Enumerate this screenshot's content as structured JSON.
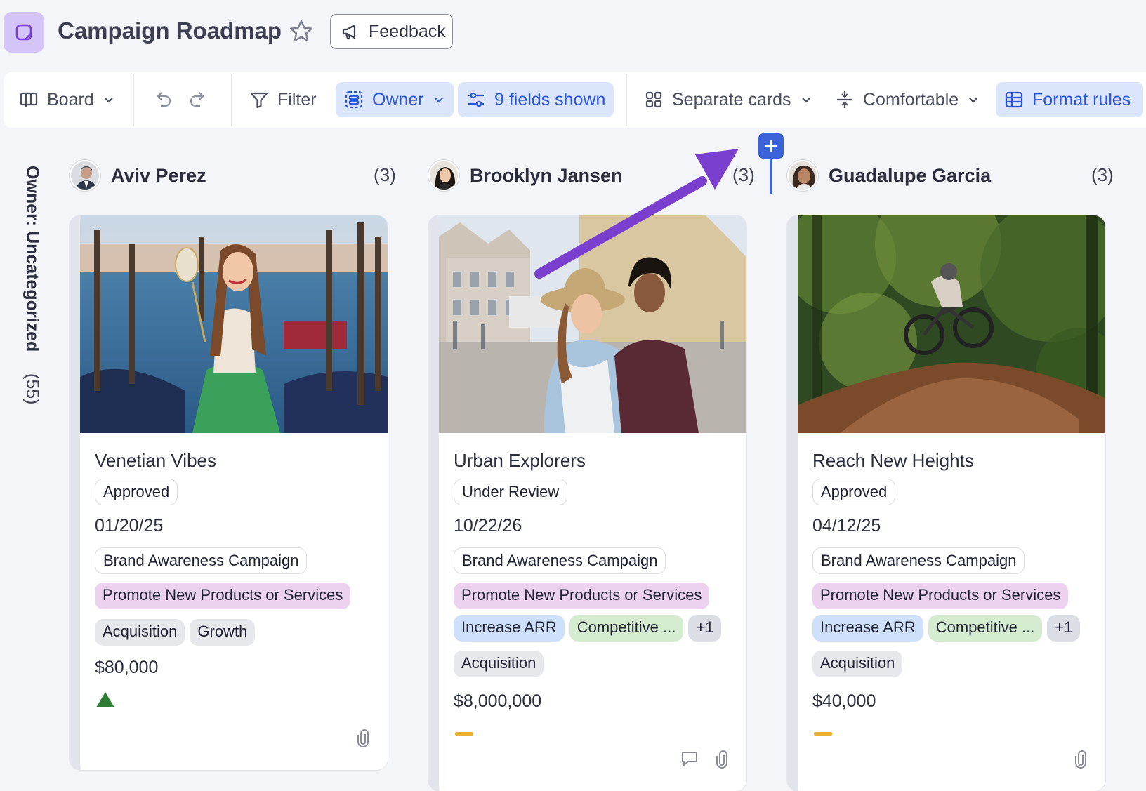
{
  "header": {
    "title": "Campaign Roadmap",
    "feedback_label": "Feedback"
  },
  "toolbar": {
    "board_label": "Board",
    "filter_label": "Filter",
    "owner_label": "Owner",
    "fields_label": "9 fields shown",
    "separate_cards_label": "Separate cards",
    "density_label": "Comfortable",
    "format_rules_label": "Format rules"
  },
  "group": {
    "label": "Owner: Uncategorized",
    "count": "(55)"
  },
  "columns": [
    {
      "name": "Aviv Perez",
      "count": "(3)",
      "card": {
        "title": "Venetian Vibes",
        "status": "Approved",
        "date": "01/20/25",
        "campaign": "Brand Awareness Campaign",
        "goal": "Promote New Products or Services",
        "tags": [
          "Acquisition",
          "Growth"
        ],
        "budget": "$80,000",
        "indicator": "up-triangle"
      }
    },
    {
      "name": "Brooklyn Jansen",
      "count": "(3)",
      "card": {
        "title": "Urban Explorers",
        "status": "Under Review",
        "date": "10/22/26",
        "campaign": "Brand Awareness Campaign",
        "goal": "Promote New Products or Services",
        "objectives": [
          "Increase ARR",
          "Competitive ...",
          "+1"
        ],
        "tags": [
          "Acquisition"
        ],
        "budget": "$8,000,000",
        "indicator": "dash"
      }
    },
    {
      "name": "Guadalupe Garcia",
      "count": "(3)",
      "card": {
        "title": "Reach New Heights",
        "status": "Approved",
        "date": "04/12/25",
        "campaign": "Brand Awareness Campaign",
        "goal": "Promote New Products or Services",
        "objectives": [
          "Increase ARR",
          "Competitive ...",
          "+1"
        ],
        "tags": [
          "Acquisition"
        ],
        "budget": "$40,000",
        "indicator": "dash"
      }
    }
  ],
  "colors": {
    "accent": "#3b62d9",
    "annotation_arrow": "#7b3fd0",
    "indicator_up": "#2e7d32",
    "indicator_flat": "#e8b030"
  }
}
